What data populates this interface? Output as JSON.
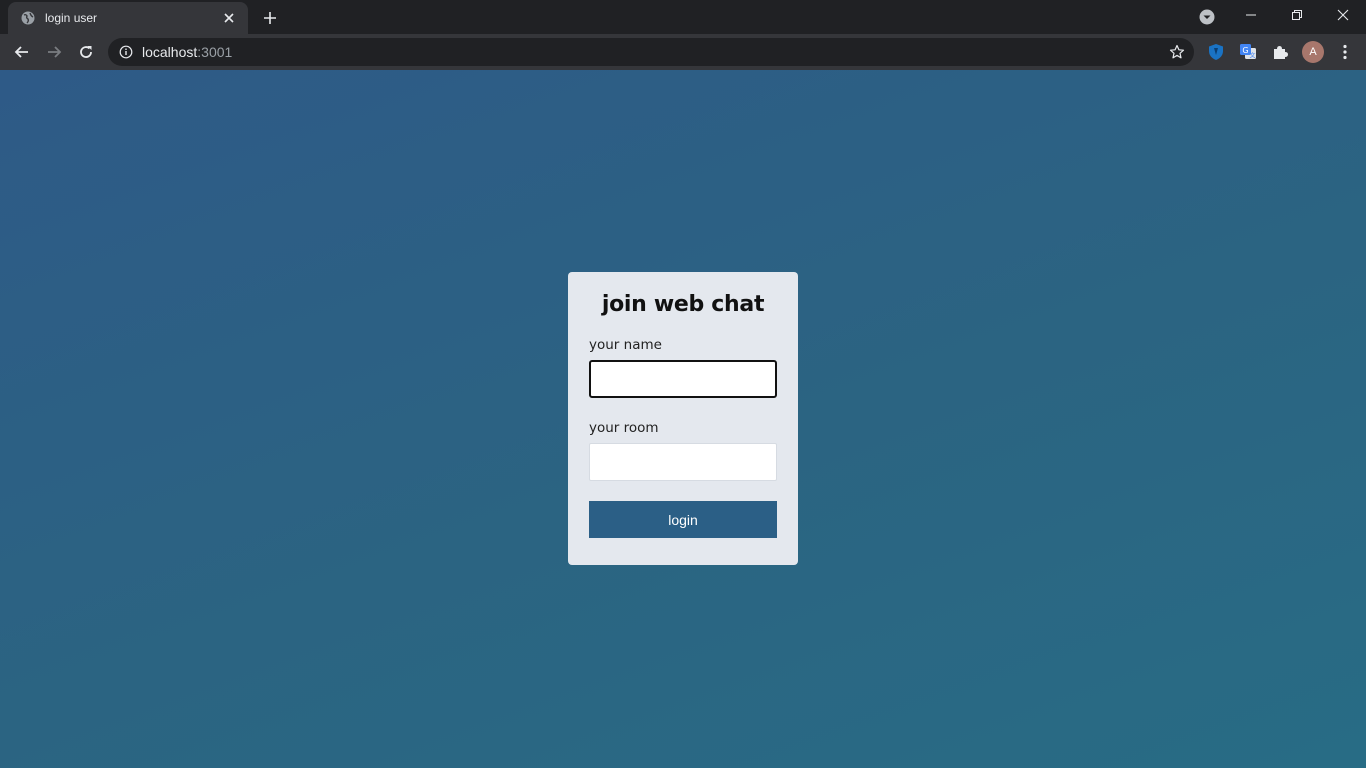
{
  "browser": {
    "tab": {
      "title": "login user",
      "favicon": "globe-icon",
      "close_icon": "close-icon"
    },
    "new_tab_icon": "plus-icon",
    "tab_search_icon": "chevron-down-icon",
    "window_controls": [
      "minimize-icon",
      "restore-icon",
      "close-icon"
    ],
    "toolbar": {
      "back_icon": "arrow-left-icon",
      "forward_icon": "arrow-right-icon",
      "reload_icon": "reload-icon",
      "site_info_icon": "info-icon",
      "url_host": "localhost",
      "url_port": ":3001",
      "bookmark_icon": "star-icon",
      "extensions": [
        "shield-extension-icon",
        "translate-extension-icon",
        "puzzle-extensions-icon"
      ],
      "profile_initial": "A",
      "menu_icon": "three-dots-icon"
    }
  },
  "page": {
    "background_gradient": [
      "#2e5a87",
      "#286c85"
    ],
    "login_card": {
      "title": "join web chat",
      "name_label": "your name",
      "name_value": "",
      "room_label": "your room",
      "room_value": "",
      "submit_label": "login",
      "button_color": "#2b5f86"
    }
  }
}
